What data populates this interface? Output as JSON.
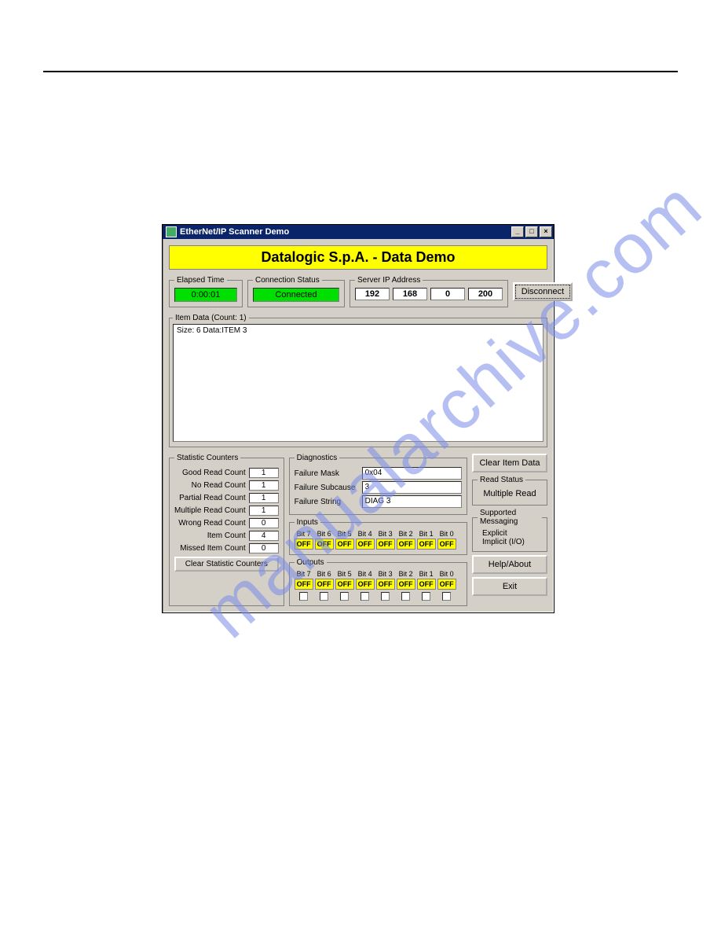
{
  "watermark": "manualarchive.com",
  "window": {
    "title": "EtherNet/IP Scanner Demo",
    "banner": "Datalogic S.p.A. - Data Demo"
  },
  "elapsed_time": {
    "legend": "Elapsed Time",
    "value": "0:00:01"
  },
  "connection_status": {
    "legend": "Connection Status",
    "value": "Connected"
  },
  "server_ip": {
    "legend": "Server IP Address",
    "octets": [
      "192",
      "168",
      "0",
      "200"
    ]
  },
  "disconnect_btn": "Disconnect",
  "item_data": {
    "legend": "Item Data (Count: 1)",
    "line": "Size: 6 Data:ITEM 3"
  },
  "stats": {
    "legend": "Statistic Counters",
    "rows": [
      {
        "label": "Good Read Count",
        "value": "1"
      },
      {
        "label": "No Read Count",
        "value": "1"
      },
      {
        "label": "Partial Read Count",
        "value": "1"
      },
      {
        "label": "Multiple Read Count",
        "value": "1"
      },
      {
        "label": "Wrong Read Count",
        "value": "0"
      },
      {
        "label": "Item Count",
        "value": "4"
      },
      {
        "label": "Missed Item Count",
        "value": "0"
      }
    ],
    "clear_btn": "Clear Statistic Counters"
  },
  "diag": {
    "legend": "Diagnostics",
    "mask_label": "Failure Mask",
    "mask_value": "0x04",
    "sub_label": "Failure Subcause",
    "sub_value": "3",
    "str_label": "Failure String",
    "str_value": "DIAG 3"
  },
  "inputs": {
    "legend": "Inputs",
    "bits": [
      "Bit 7",
      "Bit 6",
      "Bit 5",
      "Bit 4",
      "Bit 3",
      "Bit 2",
      "Bit 1",
      "Bit 0"
    ],
    "states": [
      "OFF",
      "OFF",
      "OFF",
      "OFF",
      "OFF",
      "OFF",
      "OFF",
      "OFF"
    ]
  },
  "outputs": {
    "legend": "Outputs",
    "bits": [
      "Bit 7",
      "Bit 6",
      "Bit 5",
      "Bit 4",
      "Bit 3",
      "Bit 2",
      "Bit 1",
      "Bit 0"
    ],
    "states": [
      "OFF",
      "OFF",
      "OFF",
      "OFF",
      "OFF",
      "OFF",
      "OFF",
      "OFF"
    ]
  },
  "clear_item_btn": "Clear Item Data",
  "read_status": {
    "legend": "Read Status",
    "value": "Multiple Read"
  },
  "messaging": {
    "legend": "Supported Messaging",
    "line1": "Explicit",
    "line2": "Implicit (I/O)"
  },
  "help_btn": "Help/About",
  "exit_btn": "Exit"
}
